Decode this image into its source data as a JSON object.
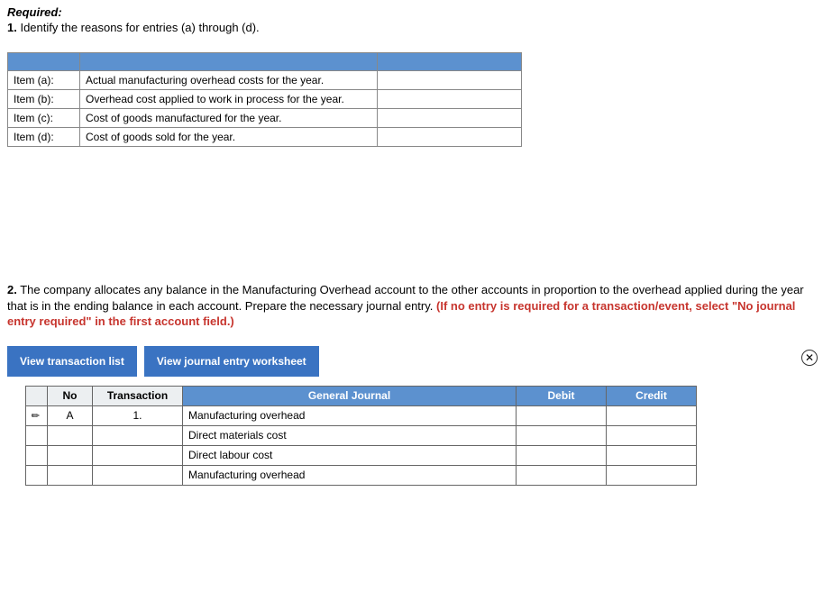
{
  "required_label": "Required:",
  "q1": {
    "num": "1.",
    "text": "Identify the reasons for entries (a) through (d)."
  },
  "items": [
    {
      "label": "Item (a):",
      "value": "Actual manufacturing overhead costs for the year."
    },
    {
      "label": "Item (b):",
      "value": "Overhead cost applied to work in process for the year."
    },
    {
      "label": "Item (c):",
      "value": "Cost of goods manufactured for the year."
    },
    {
      "label": "Item (d):",
      "value": "Cost of goods sold for the year."
    }
  ],
  "q2": {
    "num": "2.",
    "text": "The company allocates any balance in the Manufacturing Overhead account to the other accounts in proportion to the overhead applied during the year that is in the ending balance in each account. Prepare the necessary journal entry. ",
    "red": "(If no entry is required for a transaction/event, select \"No journal entry required\" in the first account field.)"
  },
  "tabs": {
    "view_transaction_list": "View transaction list",
    "view_journal_worksheet": "View journal entry worksheet"
  },
  "journal_headers": {
    "no": "No",
    "transaction": "Transaction",
    "general_journal": "General Journal",
    "debit": "Debit",
    "credit": "Credit"
  },
  "journal_rows": [
    {
      "no": "A",
      "transaction": "1.",
      "gj": "Manufacturing overhead",
      "debit": "",
      "credit": ""
    },
    {
      "no": "",
      "transaction": "",
      "gj": "Direct materials cost",
      "debit": "",
      "credit": ""
    },
    {
      "no": "",
      "transaction": "",
      "gj": "Direct labour cost",
      "debit": "",
      "credit": ""
    },
    {
      "no": "",
      "transaction": "",
      "gj": "Manufacturing overhead",
      "debit": "",
      "credit": ""
    }
  ]
}
